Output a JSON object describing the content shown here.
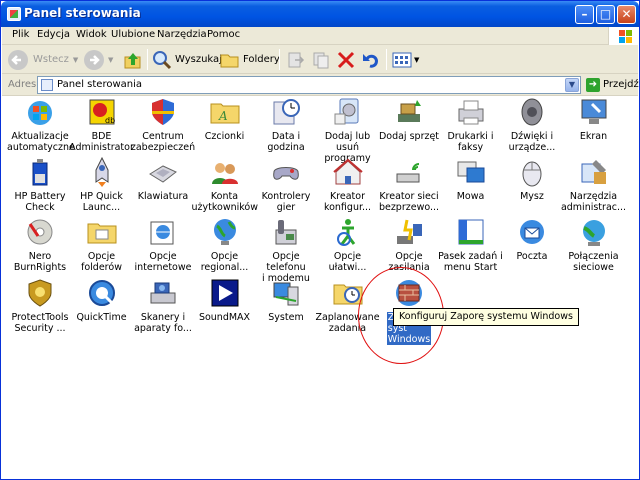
{
  "window": {
    "title": "Panel sterowania"
  },
  "menubar": {
    "items": [
      "Plik",
      "Edycja",
      "Widok",
      "Ulubione",
      "Narzędzia",
      "Pomoc"
    ]
  },
  "toolbar": {
    "back_label": "Wstecz",
    "search_label": "Wyszukaj",
    "folders_label": "Foldery"
  },
  "address": {
    "label": "Adres",
    "value": "Panel sterowania",
    "go_label": "Przejdź"
  },
  "items": [
    {
      "label": "Aktualizacje\nautomatyczne",
      "icon": "windows-update-icon"
    },
    {
      "label": "BDE\nAdministrator",
      "icon": "bde-admin-icon"
    },
    {
      "label": "Centrum\nzabezpieczeń",
      "icon": "security-shield-icon"
    },
    {
      "label": "Czcionki",
      "icon": "fonts-folder-icon"
    },
    {
      "label": "Data i godzina",
      "icon": "clock-icon"
    },
    {
      "label": "Dodaj lub usuń\nprogramy",
      "icon": "add-remove-programs-icon"
    },
    {
      "label": "Dodaj sprzęt",
      "icon": "add-hardware-icon"
    },
    {
      "label": "Drukarki i\nfaksy",
      "icon": "printer-icon"
    },
    {
      "label": "Dźwięki i\nurządze...",
      "icon": "speaker-icon"
    },
    {
      "label": "Ekran",
      "icon": "display-icon"
    },
    {
      "label": "HP Battery\nCheck",
      "icon": "battery-icon"
    },
    {
      "label": "HP Quick\nLaunc...",
      "icon": "rocket-icon"
    },
    {
      "label": "Klawiatura",
      "icon": "keyboard-icon"
    },
    {
      "label": "Konta\nużytkowników",
      "icon": "users-icon"
    },
    {
      "label": "Kontrolery gier",
      "icon": "gamepad-icon"
    },
    {
      "label": "Kreator\nkonfigur...",
      "icon": "network-setup-house-icon"
    },
    {
      "label": "Kreator sieci\nbezprzewo...",
      "icon": "wireless-icon"
    },
    {
      "label": "Mowa",
      "icon": "speech-icon"
    },
    {
      "label": "Mysz",
      "icon": "mouse-icon"
    },
    {
      "label": "Narzędzia\nadministrac...",
      "icon": "admin-tools-icon"
    },
    {
      "label": "Nero\nBurnRights",
      "icon": "nero-icon"
    },
    {
      "label": "Opcje\nfolderów",
      "icon": "folder-options-icon"
    },
    {
      "label": "Opcje\ninternetowe",
      "icon": "internet-options-icon"
    },
    {
      "label": "Opcje\nregional...",
      "icon": "globe-icon"
    },
    {
      "label": "Opcje telefonu\ni modemu",
      "icon": "phone-icon"
    },
    {
      "label": "Opcje\nułatwi...",
      "icon": "accessibility-icon"
    },
    {
      "label": "Opcje zasilania",
      "icon": "power-icon"
    },
    {
      "label": "Pasek zadań i\nmenu Start",
      "icon": "taskbar-icon"
    },
    {
      "label": "Poczta",
      "icon": "mail-icon"
    },
    {
      "label": "Połączenia\nsieciowe",
      "icon": "network-connections-icon"
    },
    {
      "label": "ProtectTools\nSecurity ...",
      "icon": "protecttools-icon"
    },
    {
      "label": "QuickTime",
      "icon": "quicktime-icon"
    },
    {
      "label": "Skanery i\naparaty fo...",
      "icon": "scanner-icon"
    },
    {
      "label": "SoundMAX",
      "icon": "soundmax-icon"
    },
    {
      "label": "System",
      "icon": "system-icon"
    },
    {
      "label": "Zaplanowane\nzadania",
      "icon": "scheduled-tasks-icon"
    },
    {
      "label": "Zapo\nsyst\nWindows",
      "icon": "firewall-icon",
      "selected": true
    }
  ],
  "tooltip": {
    "text": "Konfiguruj Zaporę systemu Windows"
  }
}
